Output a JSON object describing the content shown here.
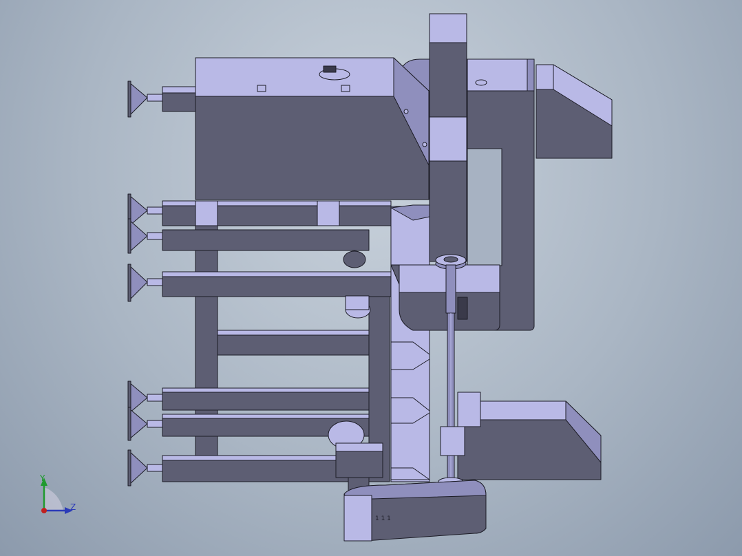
{
  "viewport": {
    "background_top": "#c9d2dc",
    "background_bottom": "#8c9aac"
  },
  "model": {
    "colors": {
      "light_face": "#b9b9e6",
      "mid_face": "#8f8fbd",
      "dark_face": "#5d5e73",
      "edge": "#1c1c26"
    },
    "cylinder_marking": "1 1 1"
  },
  "triad": {
    "y_label": "Y",
    "z_label": "Z",
    "y_color": "#1f9a2e",
    "z_color": "#2b3bb8",
    "x_color": "#c0201f"
  }
}
